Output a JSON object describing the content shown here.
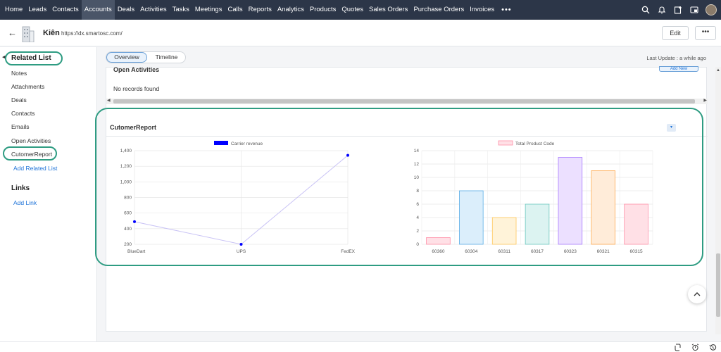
{
  "nav": {
    "items": [
      "Home",
      "Leads",
      "Contacts",
      "Accounts",
      "Deals",
      "Activities",
      "Tasks",
      "Meetings",
      "Calls",
      "Reports",
      "Analytics",
      "Products",
      "Quotes",
      "Sales Orders",
      "Purchase Orders",
      "Invoices"
    ],
    "active": "Accounts",
    "more": "•••",
    "icons": [
      "search-icon",
      "bell-icon",
      "add-entry-icon",
      "picture-in-picture-icon",
      "avatar"
    ]
  },
  "record": {
    "name": "Kiên",
    "url": "https://dx.smartosc.com/",
    "edit_label": "Edit",
    "more_label": "•••",
    "back_icon": "←"
  },
  "sidebar": {
    "collapse_icon": "◀",
    "related_title": "Related List",
    "items": [
      "Notes",
      "Attachments",
      "Deals",
      "Contacts",
      "Emails",
      "Open Activities",
      "CutomerReport"
    ],
    "add_related": "Add Related List",
    "links_title": "Links",
    "add_link": "Add Link"
  },
  "tabs": {
    "overview": "Overview",
    "timeline": "Timeline",
    "last_update": "Last Update : a while ago"
  },
  "open_activities": {
    "title": "Open Activities",
    "add_new": "Add New",
    "empty": "No records found"
  },
  "report": {
    "title": "CutomerReport",
    "toggle_icon": "▾"
  },
  "chart_data": [
    {
      "type": "line",
      "legend": "Carrier revenue",
      "color": "#0000ff",
      "categories": [
        "BlueDart",
        "UPS",
        "FedEX"
      ],
      "values": [
        490,
        200,
        1340
      ],
      "ylim": [
        200,
        1400
      ],
      "yticks": [
        "1,400",
        "1,200",
        "1,000",
        "800",
        "600",
        "400",
        "200"
      ],
      "grid": true,
      "legend_position": "top"
    },
    {
      "type": "bar",
      "legend": "Total Product Code",
      "categories": [
        "60360",
        "60304",
        "60311",
        "60317",
        "60323",
        "60321",
        "60315"
      ],
      "values": [
        1,
        8,
        4,
        6,
        13,
        11,
        6
      ],
      "ylim": [
        0,
        14
      ],
      "yticks": [
        "14",
        "12",
        "10",
        "8",
        "6",
        "4",
        "2",
        "0"
      ],
      "fill_colors": [
        "#ffe0e6",
        "#dbeefb",
        "#fff3d9",
        "#dcf3f1",
        "#ece0ff",
        "#ffecd9",
        "#ffe0e6"
      ],
      "stroke_colors": [
        "#ff8fa8",
        "#5aaee6",
        "#ffc75a",
        "#6cc9c0",
        "#a97cff",
        "#ffa94d",
        "#ff8fa8"
      ],
      "grid": true,
      "legend_position": "top"
    }
  ],
  "bottom": {
    "icons": [
      "loop-icon",
      "alarm-icon",
      "history-icon"
    ]
  },
  "accent_color": "#2e9c82"
}
